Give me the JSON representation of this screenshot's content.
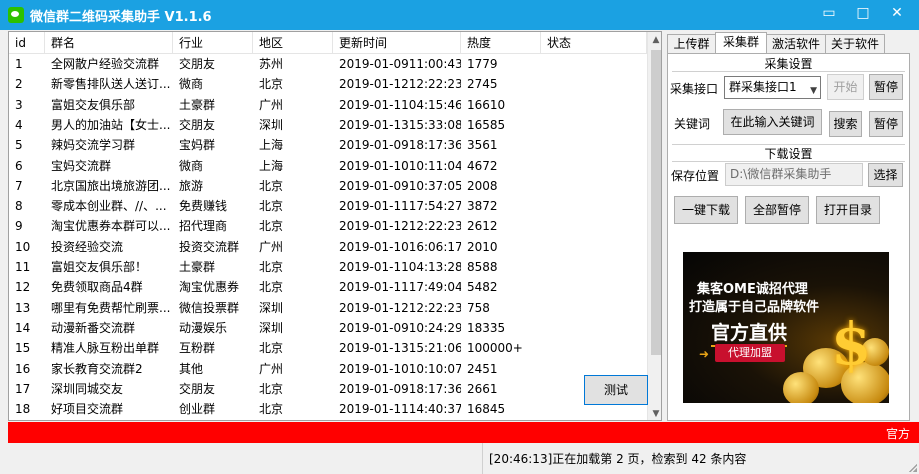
{
  "window": {
    "title": "微信群二维码采集助手  V1.1.6",
    "controls": [
      "▭",
      "□",
      "✕"
    ]
  },
  "table": {
    "columns": [
      "id",
      "群名",
      "行业",
      "地区",
      "更新时间",
      "热度",
      "状态"
    ],
    "rows": [
      [
        "1",
        "全网散户经验交流群",
        "交朋友",
        "苏州",
        "2019-01-0911:00:43",
        "1779",
        ""
      ],
      [
        "2",
        "新零售排队送人送订...",
        "微商",
        "北京",
        "2019-01-1212:22:23",
        "2745",
        ""
      ],
      [
        "3",
        "富姐交友俱乐部",
        "土豪群",
        "广州",
        "2019-01-1104:15:46",
        "16610",
        ""
      ],
      [
        "4",
        "男人的加油站【女士...",
        "交朋友",
        "深圳",
        "2019-01-1315:33:08",
        "16585",
        ""
      ],
      [
        "5",
        "辣妈交流学习群",
        "宝妈群",
        "上海",
        "2019-01-0918:17:36",
        "3561",
        ""
      ],
      [
        "6",
        "宝妈交流群",
        "微商",
        "上海",
        "2019-01-1010:11:04",
        "4672",
        ""
      ],
      [
        "7",
        "北京国旅出境旅游团...",
        "旅游",
        "北京",
        "2019-01-0910:37:05",
        "2008",
        ""
      ],
      [
        "8",
        "零成本创业群、//、...",
        "免费赚钱",
        "北京",
        "2019-01-1117:54:27",
        "3872",
        ""
      ],
      [
        "9",
        "淘宝优惠券本群可以...",
        "招代理商",
        "北京",
        "2019-01-1212:22:23",
        "2612",
        ""
      ],
      [
        "10",
        "投资经验交流",
        "投资交流群",
        "广州",
        "2019-01-1016:06:17",
        "2010",
        ""
      ],
      [
        "11",
        "富姐交友俱乐部！",
        "土豪群",
        "北京",
        "2019-01-1104:13:28",
        "8588",
        ""
      ],
      [
        "12",
        "免费领取商品4群",
        "淘宝优惠券",
        "北京",
        "2019-01-1117:49:04",
        "5482",
        ""
      ],
      [
        "13",
        "哪里有免费帮忙刷票...",
        "微信投票群",
        "深圳",
        "2019-01-1212:22:23",
        "758",
        ""
      ],
      [
        "14",
        "动漫新番交流群",
        "动漫娱乐",
        "深圳",
        "2019-01-0910:24:29",
        "18335",
        ""
      ],
      [
        "15",
        "精准人脉互粉出单群",
        "互粉群",
        "北京",
        "2019-01-1315:21:06",
        "100000+",
        ""
      ],
      [
        "16",
        "家长教育交流群2",
        "其他",
        "广州",
        "2019-01-1010:10:07",
        "2451",
        ""
      ],
      [
        "17",
        "深圳同城交友",
        "交朋友",
        "北京",
        "2019-01-0918:17:36",
        "2661",
        ""
      ],
      [
        "18",
        "好项目交流群",
        "创业群",
        "北京",
        "2019-01-1114:40:37",
        "16845",
        ""
      ]
    ],
    "test_button": "测试"
  },
  "tabs": [
    "上传群",
    "采集群",
    "激活软件",
    "关于软件"
  ],
  "collect": {
    "section_title": "采集设置",
    "api_label": "采集接口",
    "api_value": "群采集接口1",
    "start_button": "开始",
    "pause_button": "暂停",
    "keyword_label": "关键词",
    "keyword_value": "在此输入关键词",
    "search_button": "搜索",
    "pause_button_2": "暂停"
  },
  "download": {
    "section_title": "下载设置",
    "save_label": "保存位置",
    "save_path": "D:\\微信群采集助手",
    "choose_button": "选择",
    "one_click_button": "一键下载",
    "pause_all_button": "全部暂停",
    "open_dir_button": "打开目录"
  },
  "ad": {
    "line1": "集客OME诚招代理",
    "line2": "打造属于自己品牌软件",
    "line3": "官方直供",
    "agent_button": "代理加盟",
    "symbol": "$"
  },
  "marquee": "官方",
  "status": {
    "message": "[20:46:13]正在加载第 2 页，检索到 42 条内容"
  }
}
